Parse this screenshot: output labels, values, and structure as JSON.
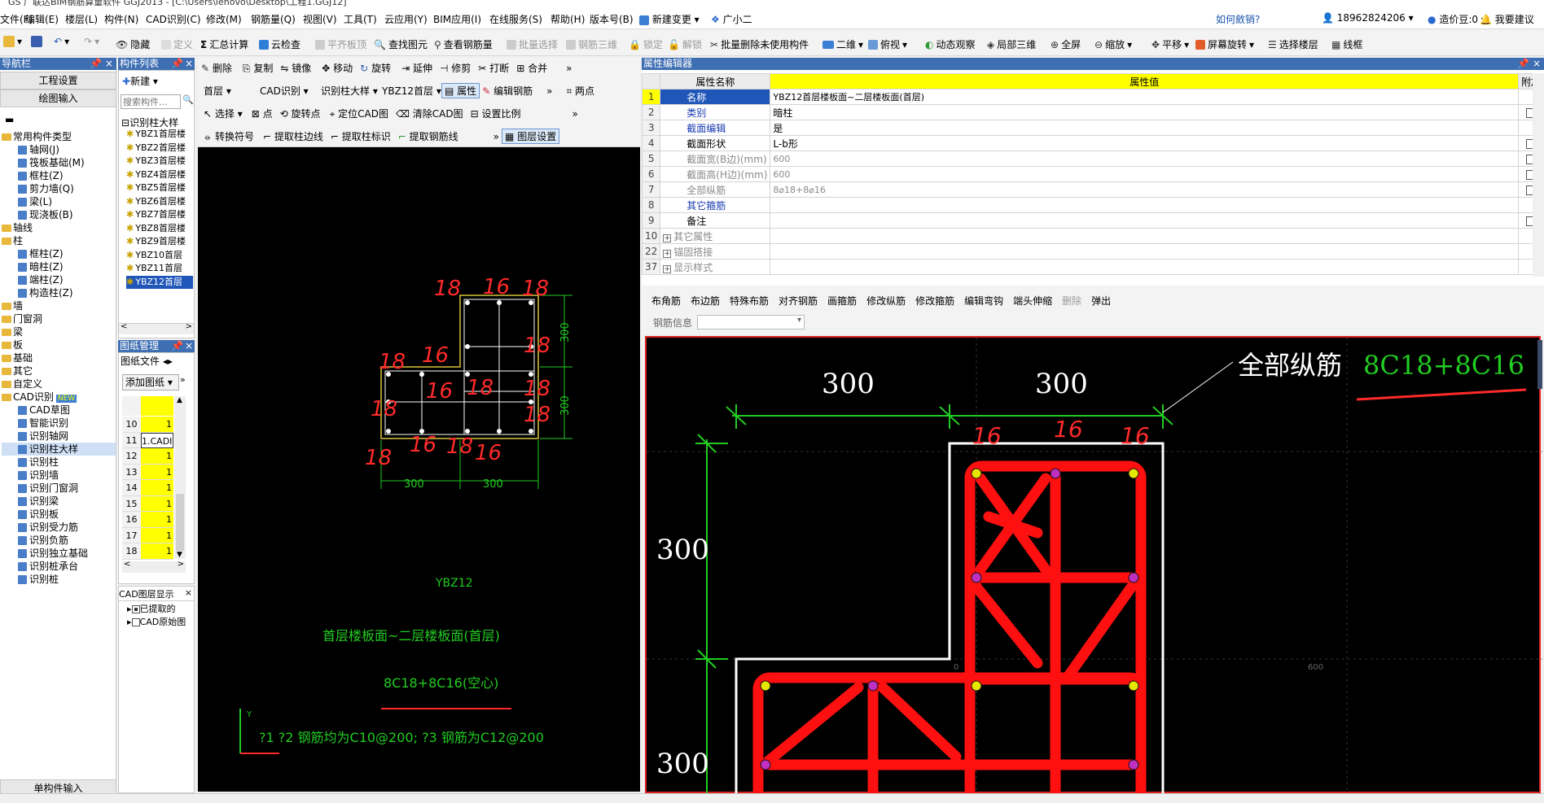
{
  "title_bar": {
    "text": "GS 广联达BIM钢筋算量软件 GGJ2013 - [C:\\Users\\lenovo\\Desktop\\工程1.GGJ12]"
  },
  "menu": {
    "items": [
      "文件(F)",
      "编辑(E)",
      "楼层(L)",
      "构件(N)",
      "CAD识别(C)",
      "修改(M)",
      "钢筋量(Q)",
      "视图(V)",
      "工具(T)",
      "云应用(Y)",
      "BIM应用(I)",
      "在线服务(S)",
      "帮助(H)",
      "版本号(B)",
      "新建变更",
      "广小二"
    ],
    "how_cost": "如何斂销?",
    "phone": "18962824206",
    "beans": "造价豆:0",
    "suggest": "我要建议"
  },
  "toolbar1": {
    "items": [
      "隐藏",
      "定义",
      "汇总计算",
      "云检查",
      "平齐板顶",
      "查找图元",
      "查看钢筋量",
      "批量选择",
      "钢筋三维",
      "锁定",
      "解锁",
      "批量删除未使用构件",
      "二维",
      "俯视",
      "动态观察",
      "局部三维",
      "全屏",
      "缩放",
      "平移",
      "屏幕旋转",
      "选择楼层",
      "线框"
    ]
  },
  "nav": {
    "title": "导航栏",
    "buttons": [
      "工程设置",
      "绘图输入"
    ],
    "tree": [
      {
        "label": "常用构件类型",
        "level": 0,
        "type": "folder"
      },
      {
        "label": "轴网(J)",
        "level": 1
      },
      {
        "label": "筏板基础(M)",
        "level": 1
      },
      {
        "label": "框柱(Z)",
        "level": 1
      },
      {
        "label": "剪力墙(Q)",
        "level": 1
      },
      {
        "label": "梁(L)",
        "level": 1
      },
      {
        "label": "现浇板(B)",
        "level": 1
      },
      {
        "label": "轴线",
        "level": 0,
        "type": "folder"
      },
      {
        "label": "柱",
        "level": 0,
        "type": "folder"
      },
      {
        "label": "框柱(Z)",
        "level": 1
      },
      {
        "label": "暗柱(Z)",
        "level": 1
      },
      {
        "label": "端柱(Z)",
        "level": 1
      },
      {
        "label": "构造柱(Z)",
        "level": 1
      },
      {
        "label": "墙",
        "level": 0,
        "type": "folder"
      },
      {
        "label": "门窗洞",
        "level": 0,
        "type": "folder"
      },
      {
        "label": "梁",
        "level": 0,
        "type": "folder"
      },
      {
        "label": "板",
        "level": 0,
        "type": "folder"
      },
      {
        "label": "基础",
        "level": 0,
        "type": "folder"
      },
      {
        "label": "其它",
        "level": 0,
        "type": "folder"
      },
      {
        "label": "自定义",
        "level": 0,
        "type": "folder"
      },
      {
        "label": "CAD识别",
        "level": 0,
        "type": "folder",
        "badge": "NEW"
      },
      {
        "label": "CAD草图",
        "level": 1
      },
      {
        "label": "智能识别",
        "level": 1
      },
      {
        "label": "识别轴网",
        "level": 1
      },
      {
        "label": "识别柱大样",
        "level": 1,
        "selected": true
      },
      {
        "label": "识别柱",
        "level": 1
      },
      {
        "label": "识别墙",
        "level": 1
      },
      {
        "label": "识别门窗洞",
        "level": 1
      },
      {
        "label": "识别梁",
        "level": 1
      },
      {
        "label": "识别板",
        "level": 1
      },
      {
        "label": "识别受力筋",
        "level": 1
      },
      {
        "label": "识别负筋",
        "level": 1
      },
      {
        "label": "识别独立基础",
        "level": 1
      },
      {
        "label": "识别桩承台",
        "level": 1
      },
      {
        "label": "识别桩",
        "level": 1
      }
    ],
    "bottom_button": "单构件输入"
  },
  "components": {
    "title": "构件列表",
    "new_label": "新建",
    "search_placeholder": "搜索构件...",
    "root": "识别柱大样",
    "items": [
      "YBZ1首层楼",
      "YBZ2首层楼",
      "YBZ3首层楼",
      "YBZ4首层楼",
      "YBZ5首层楼",
      "YBZ6首层楼",
      "YBZ7首层楼",
      "YBZ8首层楼",
      "YBZ9首层楼",
      "YBZ10首层",
      "YBZ11首层",
      "YBZ12首层"
    ]
  },
  "drawings": {
    "title": "图纸管理",
    "tab": "图纸文件",
    "add_label": "添加图纸",
    "rows": [
      {
        "n": "10",
        "v": "1"
      },
      {
        "n": "11",
        "v": "1.CADI"
      },
      {
        "n": "12",
        "v": "1"
      },
      {
        "n": "13",
        "v": "1"
      },
      {
        "n": "14",
        "v": "1"
      },
      {
        "n": "15",
        "v": "1"
      },
      {
        "n": "16",
        "v": "1"
      },
      {
        "n": "17",
        "v": "1"
      },
      {
        "n": "18",
        "v": "1"
      }
    ]
  },
  "layers": {
    "title": "CAD图层显示",
    "items": [
      "已提取的",
      "CAD原始图"
    ]
  },
  "cad_toolbar": {
    "row1": [
      "删除",
      "复制",
      "镜像",
      "移动",
      "旋转",
      "延伸",
      "修剪",
      "打断",
      "合并"
    ],
    "row2": {
      "floor": "首层",
      "cad": "CAD识别",
      "type": "识别柱大样",
      "comp": "YBZ12首层",
      "attr": "属性",
      "edit": "编辑钢筋",
      "two_points": "两点"
    },
    "row3": [
      "选择",
      "点",
      "旋转点",
      "定位CAD图",
      "清除CAD图",
      "设置比例"
    ],
    "row4": [
      "转换符号",
      "提取柱边线",
      "提取柱标识",
      "提取钢筋线",
      "图层设置"
    ]
  },
  "cad_drawing": {
    "dims": [
      "300",
      "300",
      "300",
      "300"
    ],
    "name": "YBZ12",
    "range": "首层楼板面~二层楼板面(首层)",
    "rebar": "8C18+8C16(空心)",
    "note": "?1 ?2 钢筋均为C10@200; ?3 钢筋为C12@200",
    "handwritten": [
      "18",
      "16",
      "18",
      "18",
      "16",
      "18",
      "18",
      "18",
      "16",
      "18",
      "18",
      "16",
      "18",
      "16",
      "18"
    ]
  },
  "property_editor": {
    "title": "属性编辑器",
    "headers": [
      "属性名称",
      "属性值",
      "附加"
    ],
    "rows": [
      {
        "n": "1",
        "name": "名称",
        "value": "YBZ12首层楼板面~二层楼板面(首层)",
        "style": "sel",
        "cb": false
      },
      {
        "n": "2",
        "name": "类别",
        "value": "暗柱",
        "style": "blue",
        "cb": true
      },
      {
        "n": "3",
        "name": "截面编辑",
        "value": "是",
        "style": "blue",
        "cb": false
      },
      {
        "n": "4",
        "name": "截面形状",
        "value": "L-b形",
        "style": "normal",
        "cb": true
      },
      {
        "n": "5",
        "name": "截面宽(B边)(mm)",
        "value": "600",
        "style": "gray",
        "cb": true
      },
      {
        "n": "6",
        "name": "截面高(H边)(mm)",
        "value": "600",
        "style": "gray",
        "cb": true
      },
      {
        "n": "7",
        "name": "全部纵筋",
        "value": "8⌀18+8⌀16",
        "style": "gray",
        "cb": true
      },
      {
        "n": "8",
        "name": "其它箍筋",
        "value": "",
        "style": "blue",
        "cb": false
      },
      {
        "n": "9",
        "name": "备注",
        "value": "",
        "style": "normal",
        "cb": true
      },
      {
        "n": "10",
        "name": "其它属性",
        "value": "",
        "style": "group",
        "cb": false
      },
      {
        "n": "22",
        "name": "锚固搭接",
        "value": "",
        "style": "group",
        "cb": false
      },
      {
        "n": "37",
        "name": "显示样式",
        "value": "",
        "style": "group",
        "cb": false
      }
    ]
  },
  "rebar_toolbar": {
    "items": [
      "布角筋",
      "布边筋",
      "特殊布筋",
      "对齐钢筋",
      "画箍筋",
      "修改纵筋",
      "修改箍筋",
      "编辑弯钩",
      "端头伸缩",
      "删除",
      "弹出"
    ],
    "info_label": "钢筋信息"
  },
  "rebar_view": {
    "label": "全部纵筋",
    "value": "8C18+8C16",
    "dims": [
      "300",
      "300",
      "300",
      "300"
    ],
    "tiny_labels": [
      "0",
      "600"
    ],
    "handwritten": [
      "16",
      "16",
      "16"
    ]
  }
}
